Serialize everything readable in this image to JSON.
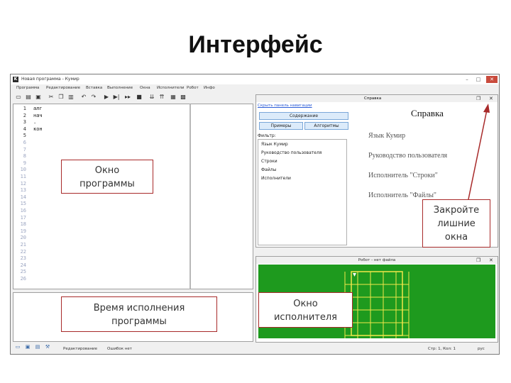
{
  "slide": {
    "title": "Интерфейс"
  },
  "window": {
    "title": "Новая программа - Кумир",
    "controls": [
      "–",
      "□",
      "✕"
    ]
  },
  "menu": [
    "Программа",
    "Редактирование",
    "Вставка",
    "Выполнение",
    "Окна",
    "Исполнители",
    "Робот",
    "Инфо"
  ],
  "editor": {
    "line_numbers": [
      "1",
      "2",
      "3",
      "4",
      "5",
      "6",
      "7",
      "8",
      "9",
      "10",
      "11",
      "12",
      "13",
      "14",
      "15",
      "16",
      "17",
      "18",
      "19",
      "20",
      "21",
      "22",
      "23",
      "24",
      "25",
      "26"
    ],
    "code_lines": [
      "алг",
      "нач",
      ".",
      "кон"
    ]
  },
  "status": {
    "mode": "Редактирование",
    "errors": "Ошибок нет",
    "position": "Стр: 1, Кол: 1",
    "language": "рус"
  },
  "help": {
    "panel_title": "Справка",
    "hide_link": "Скрыть панель навигации",
    "contents_button": "Содержание",
    "tab_examples": "Примеры",
    "tab_algorithms": "Алгоритмы",
    "filter_label": "Фильтр:",
    "tree_items": [
      "Язык Кумир",
      "Руководство пользователя",
      "Строки",
      "Файлы",
      "Исполнители"
    ],
    "heading": "Справка",
    "links": [
      "Язык Кумир",
      "Руководство пользователя",
      "Исполнитель \"Строки\"",
      "Исполнитель \"Файлы\""
    ]
  },
  "robot": {
    "title": "Робот - нет файла"
  },
  "callouts": {
    "program_window": "Окно\nпрограммы",
    "close_extra": "Закройте\nлишние\nокна",
    "run_time": "Время исполнения\nпрограммы",
    "executor_window": "Окно\nисполнителя"
  },
  "colors": {
    "field_green": "#1e9a1e",
    "callout_border": "#a82a2a",
    "field_lines": "#f2e84a"
  },
  "icons": [
    "app-icon",
    "new-file-icon",
    "open-icon",
    "save-icon",
    "cut-icon",
    "copy-icon",
    "paste-icon",
    "undo-icon",
    "redo-icon",
    "run-icon",
    "step-icon",
    "pause-icon",
    "stop-icon"
  ]
}
